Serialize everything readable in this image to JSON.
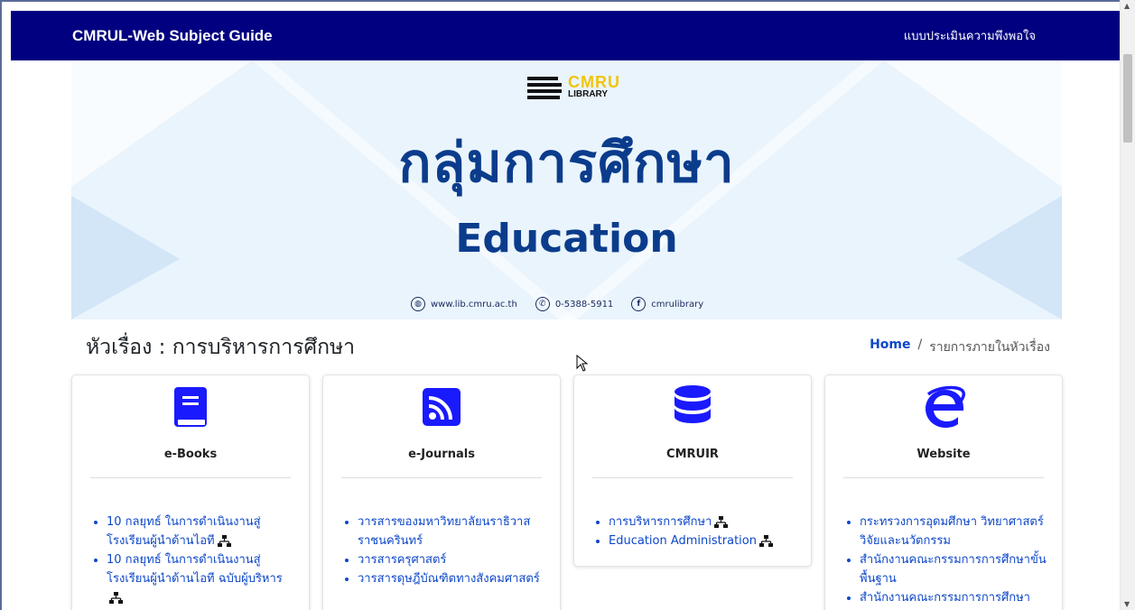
{
  "navbar": {
    "brand": "CMRUL-Web Subject Guide",
    "survey_link": "แบบประเมินความพึงพอใจ"
  },
  "banner": {
    "logo_top": "CMRU",
    "logo_bottom": "LIBRARY",
    "title_th": "กลุ่มการศึกษา",
    "title_en": "Education",
    "website": "www.lib.cmru.ac.th",
    "phone": "0-5388-5911",
    "facebook": "cmrulibrary"
  },
  "page": {
    "title": "หัวเรื่อง : การบริหารการศึกษา",
    "breadcrumb_home": "Home",
    "breadcrumb_sep": "/",
    "breadcrumb_current": "รายการภายในหัวเรื่อง"
  },
  "cards": [
    {
      "title": "e-Books",
      "icon": "book-icon",
      "items": [
        "10 กลยุทธ์ ในการดำเนินงานสู่โรงเรียนผู้นำด้านไอที",
        "10 กลยุทธ์ ในการดำเนินงานสู่โรงเรียนผู้นำด้านไอที ฉบับผู้บริหาร"
      ]
    },
    {
      "title": "e-Journals",
      "icon": "rss-icon",
      "items": [
        "วารสารของมหาวิทยาลัยนราธิวาสราชนครินทร์",
        "วารสารครุศาสตร์",
        "วารสารดุษฎีบัณฑิตทางสังคมศาสตร์"
      ]
    },
    {
      "title": "CMRUIR",
      "icon": "database-icon",
      "items": [
        "การบริหารการศึกษา",
        "Education Administration"
      ]
    },
    {
      "title": "Website",
      "icon": "internet-explorer-icon",
      "items": [
        "กระทรวงการอุดมศึกษา วิทยาศาสตร์ วิจัยและนวัตกรรม",
        "สำนักงานคณะกรรมการการศึกษาขั้นพื้นฐาน",
        "สำนักงานคณะกรรมการการศึกษา"
      ]
    }
  ],
  "colors": {
    "navbar": "#000080",
    "link": "#0d47c9",
    "banner_text": "#0b3c8c",
    "icon_blue": "#1a1aff"
  }
}
